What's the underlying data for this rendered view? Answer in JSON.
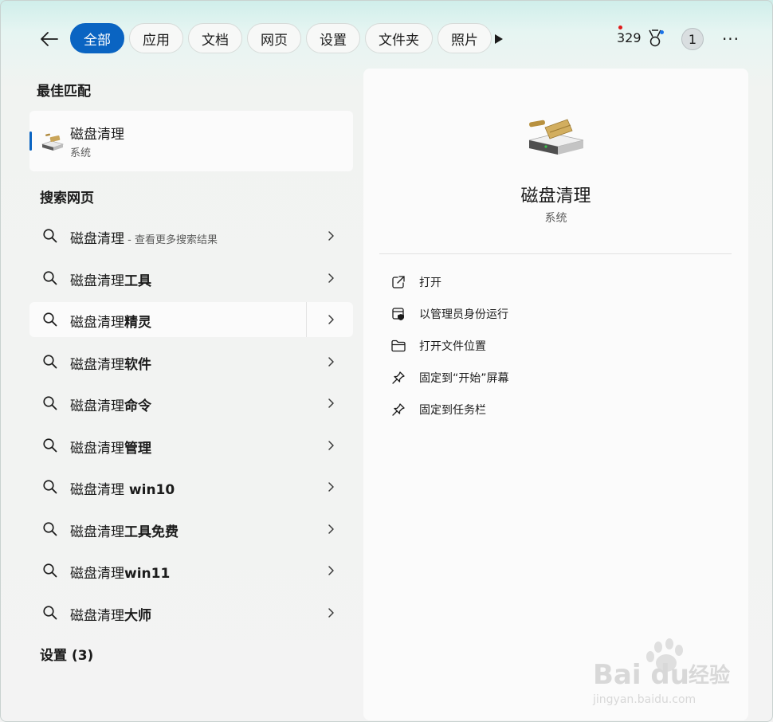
{
  "filters": [
    "全部",
    "应用",
    "文档",
    "网页",
    "设置",
    "文件夹",
    "照片"
  ],
  "score": "329",
  "avatar_initial": "1",
  "more_label": "···",
  "best_match": {
    "section_title": "最佳匹配",
    "name": "磁盘清理",
    "sub": "系统"
  },
  "web_search": {
    "section_title": "搜索网页",
    "items": [
      {
        "prefix": "磁盘清理",
        "bold": "",
        "hint": " - 查看更多搜索结果"
      },
      {
        "prefix": "磁盘清理",
        "bold": "工具",
        "hint": ""
      },
      {
        "prefix": "磁盘清理",
        "bold": "精灵",
        "hint": ""
      },
      {
        "prefix": "磁盘清理",
        "bold": "软件",
        "hint": ""
      },
      {
        "prefix": "磁盘清理",
        "bold": "命令",
        "hint": ""
      },
      {
        "prefix": "磁盘清理",
        "bold": "管理",
        "hint": ""
      },
      {
        "prefix": "磁盘清理",
        "bold": " win10",
        "hint": ""
      },
      {
        "prefix": "磁盘清理",
        "bold": "工具免费",
        "hint": ""
      },
      {
        "prefix": "磁盘清理",
        "bold": "win11",
        "hint": ""
      },
      {
        "prefix": "磁盘清理",
        "bold": "大师",
        "hint": ""
      }
    ]
  },
  "settings_section": "设置 (3)",
  "preview": {
    "title": "磁盘清理",
    "subtitle": "系统",
    "actions": [
      {
        "label": "打开",
        "icon": "open-external-icon"
      },
      {
        "label": "以管理员身份运行",
        "icon": "admin-shield-icon"
      },
      {
        "label": "打开文件位置",
        "icon": "folder-icon"
      },
      {
        "label": "固定到“开始”屏幕",
        "icon": "pin-icon"
      },
      {
        "label": "固定到任务栏",
        "icon": "pin-icon"
      }
    ]
  },
  "watermark": {
    "brand": "Bai du",
    "cn": "经验",
    "url": "jingyan.baidu.com"
  },
  "colors": {
    "accent": "#0a64c2",
    "panel": "#fbfbfb"
  }
}
